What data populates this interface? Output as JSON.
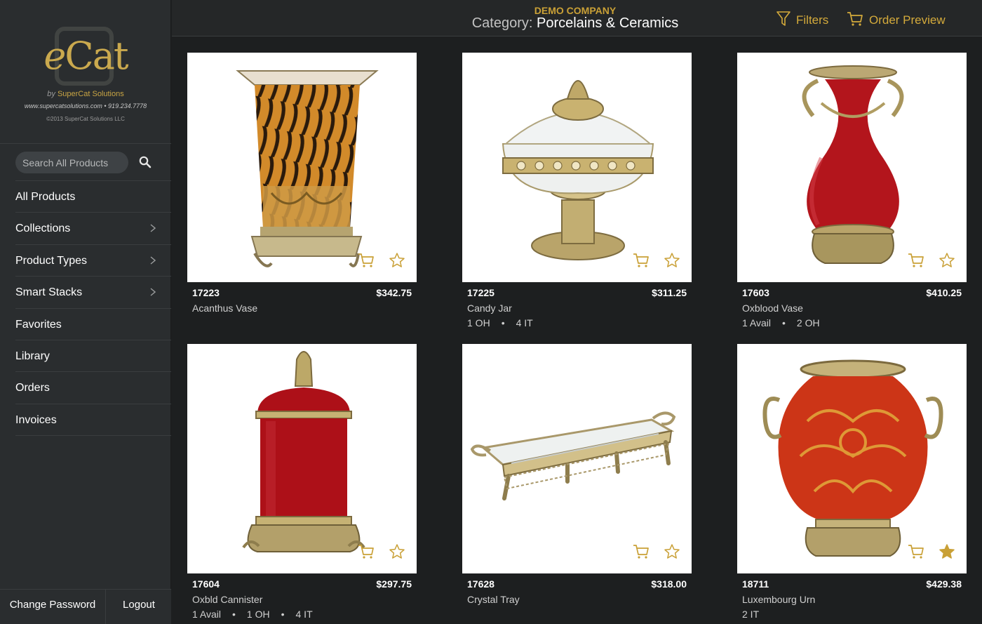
{
  "branding": {
    "logo_e": "e",
    "logo_cat": "Cat",
    "by_label": "by",
    "by_company": "SuperCat Solutions",
    "contact": "www.supercatsolutions.com  •  919.234.7778",
    "copyright": "©2013 SuperCat Solutions LLC"
  },
  "search": {
    "placeholder": "Search All Products"
  },
  "nav": [
    {
      "label": "All Products",
      "chevron": false
    },
    {
      "label": "Collections",
      "chevron": true
    },
    {
      "label": "Product Types",
      "chevron": true
    },
    {
      "label": "Smart Stacks",
      "chevron": true
    },
    {
      "label": "Favorites",
      "chevron": false
    },
    {
      "label": "Library",
      "chevron": false
    },
    {
      "label": "Orders",
      "chevron": false
    },
    {
      "label": "Invoices",
      "chevron": false
    }
  ],
  "bottom": {
    "change_password": "Change Password",
    "logout": "Logout"
  },
  "header": {
    "company": "DEMO COMPANY",
    "category_label": "Category:",
    "category_name": "Porcelains & Ceramics",
    "filters": "Filters",
    "order_preview": "Order Preview"
  },
  "colors": {
    "accent": "#c9a036",
    "sidebar": "#2a2d2f",
    "background": "#1d1f20"
  },
  "products": [
    {
      "sku": "17223",
      "price": "$342.75",
      "name": "Acanthus Vase",
      "avail": [],
      "favorite": false
    },
    {
      "sku": "17225",
      "price": "$311.25",
      "name": "Candy Jar",
      "avail": [
        "1 OH",
        "4 IT"
      ],
      "favorite": false
    },
    {
      "sku": "17603",
      "price": "$410.25",
      "name": "Oxblood Vase",
      "avail": [
        "1 Avail",
        "2 OH"
      ],
      "favorite": false
    },
    {
      "sku": "17604",
      "price": "$297.75",
      "name": "Oxbld Cannister",
      "avail": [
        "1 Avail",
        "1 OH",
        "4 IT"
      ],
      "favorite": false
    },
    {
      "sku": "17628",
      "price": "$318.00",
      "name": "Crystal Tray",
      "avail": [],
      "favorite": false
    },
    {
      "sku": "18711",
      "price": "$429.38",
      "name": "Luxembourg Urn",
      "avail": [
        "2 IT"
      ],
      "favorite": true
    }
  ]
}
